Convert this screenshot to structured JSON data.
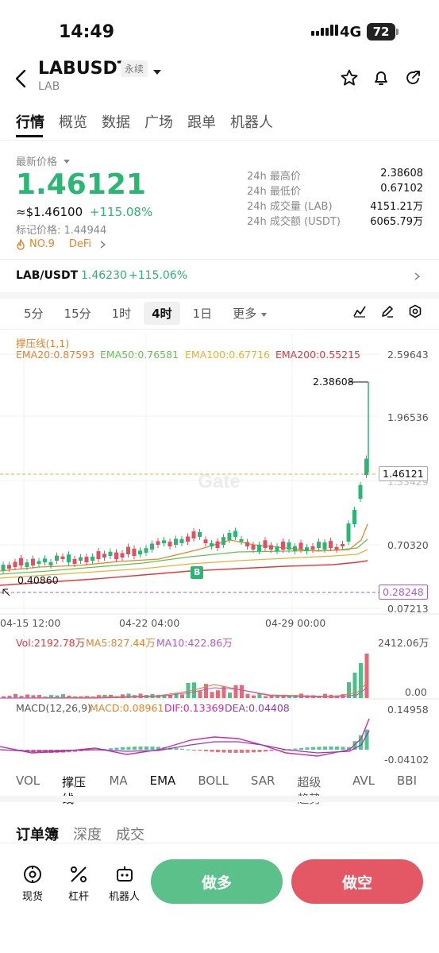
{
  "status": {
    "time": "14:49",
    "network": "4G",
    "battery": "72"
  },
  "header": {
    "title": "LABUSDT",
    "badge": "永续",
    "subtitle": "LAB"
  },
  "tabs": [
    "行情",
    "概览",
    "数据",
    "广场",
    "跟单",
    "机器人"
  ],
  "price": {
    "label": "最新价格",
    "value": "1.46121",
    "usd": "≈$1.46100",
    "change": "+115.08%",
    "mark": "标记价格: 1.44944",
    "rank": "NO.9",
    "tag": "DeFi"
  },
  "stats": [
    {
      "label": "24h 最高价",
      "value": "2.38608"
    },
    {
      "label": "24h 最低价",
      "value": "0.67102"
    },
    {
      "label": "24h 成交量 (LAB)",
      "value": "4151.21万"
    },
    {
      "label": "24h 成交额 (USDT)",
      "value": "6065.79万"
    }
  ],
  "spot": {
    "pair": "LAB/USDT",
    "price": "1.46230",
    "change": "+115.06%"
  },
  "intervals": [
    "5分",
    "15分",
    "1时",
    "4时",
    "1日",
    "更多"
  ],
  "active_interval": "4时",
  "chart_labels": {
    "indicator": "撑压线(1,1)",
    "ema20": "EMA20:0.87593",
    "ema50": "EMA50:0.76581",
    "ema100": "EMA100:0.67716",
    "ema200": "EMA200:0.55215",
    "y_ticks": [
      "2.59643",
      "1.96536",
      "1.33429",
      "0.70320",
      "0.07213"
    ],
    "high_marker": "2.38608",
    "current_marker": "1.46121",
    "support_marker": "0.28248",
    "low_marker": "0.40860",
    "b_marker": "B",
    "x_ticks": [
      "04-15 12:00",
      "04-22 04:00",
      "04-29 00:00"
    ],
    "vol": "Vol:2192.78万",
    "ma5": "MA5:827.44万",
    "ma10": "MA10:422.86万",
    "vol_ticks": [
      "2412.06万",
      "0.00"
    ],
    "macd_title": "MACD(12,26,9)",
    "macd": "MACD:0.08961",
    "dif": "DIF:0.13369",
    "dea": "DEA:0.04408",
    "macd_ticks": [
      "0.14958",
      "-0.04102"
    ],
    "watermark": "Gate"
  },
  "colors": {
    "up": "#2bb673",
    "down": "#e0505e",
    "ema20": "#e8822b",
    "ema50": "#66c24e",
    "ema100": "#e8b23a",
    "ema200": "#e03a3a",
    "support": "#b455d6"
  },
  "indicator_tabs": [
    "VOL",
    "撑压线",
    "MA",
    "EMA",
    "BOLL",
    "SAR",
    "超级趋势",
    "AVL",
    "BBI"
  ],
  "orderbook_tabs": [
    "订单簿",
    "深度",
    "成交"
  ],
  "bottom": {
    "spot": "现货",
    "leverage": "杠杆",
    "robot": "机器人",
    "long": "做多",
    "short": "做空"
  }
}
